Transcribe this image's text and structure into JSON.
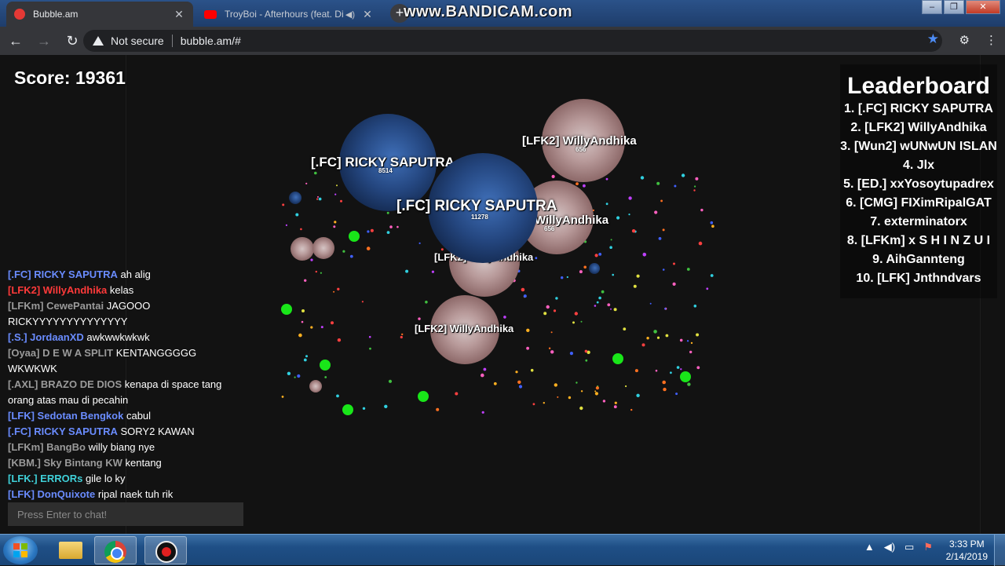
{
  "browser": {
    "tabs": [
      {
        "title": "Bubble.am",
        "active": true
      },
      {
        "title": "TroyBoi - Afterhours (feat. Di",
        "active": false
      }
    ],
    "watermark": "www.BANDICAM.com",
    "security": "Not secure",
    "url": "bubble.am/#"
  },
  "game": {
    "score": "Score: 19361",
    "leaderboard": {
      "title": "Leaderboard",
      "rows": [
        "1. [.FC] RICKY SAPUTRA",
        "2. [LFK2] WillyAndhika",
        "3. [Wun2] wUNwUN ISLAN",
        "4. Jlx",
        "5. [ED.] xxYosoytupadrex",
        "6. [CMG] FIXimRipalGAT",
        "7. exterminatorx",
        "8. [LFKm] x S H I N Z U I",
        "9. AihGannteng",
        "10. [LFK] Jnthndvars"
      ]
    },
    "chat": [
      {
        "name": "[.FC] RICKY SAPUTRA",
        "color": "#6a8cff",
        "msg": "ah alig"
      },
      {
        "name": "[LFK2] WillyAndhika",
        "color": "#ff3a3a",
        "msg": "kelas"
      },
      {
        "name": "[LFKm] CewePantai",
        "color": "#9a9a9a",
        "msg": "JAGOOO RICKYYYYYYYYYYYYYY"
      },
      {
        "name": "[.S.] JordaanXD",
        "color": "#6a8cff",
        "msg": "awkwwkwkwk"
      },
      {
        "name": "[Oyaa] D E W A SPLIT",
        "color": "#9a9a9a",
        "msg": "KENTANGGGGG WKWKWK"
      },
      {
        "name": "[.AXL] BRAZO DE DIOS",
        "color": "#9a9a9a",
        "msg": "kenapa di space tang orang atas mau di pecahin"
      },
      {
        "name": "[LFK] Sedotan Bengkok",
        "color": "#6a8cff",
        "msg": "cabul"
      },
      {
        "name": "[.FC] RICKY SAPUTRA",
        "color": "#6a8cff",
        "msg": "SORY2 KAWAN"
      },
      {
        "name": "[LFKm] BangBo",
        "color": "#9a9a9a",
        "msg": "willy biang nye"
      },
      {
        "name": "[KBM.] Sky Bintang KW",
        "color": "#9a9a9a",
        "msg": "kentang"
      },
      {
        "name": "[LFK.] ERRORs",
        "color": "#3fd0d8",
        "msg": "gile lo ky"
      },
      {
        "name": "[LFK] DonQuixote",
        "color": "#6a8cff",
        "msg": "ripal naek tuh rik"
      }
    ],
    "chat_placeholder": "Press Enter to chat!",
    "cells": [
      {
        "label": "[.FC] RICKY SAPUTRA",
        "mass": "8514"
      },
      {
        "label": "[LFK2] WillyAndhika",
        "mass": "656"
      },
      {
        "label": "[.FC] RICKY SAPUTRA",
        "mass": "11278"
      },
      {
        "label": "WillyAndhika",
        "mass": "656"
      },
      {
        "label": "[LFK2] WillyAndhika",
        "mass": "656"
      },
      {
        "label": "[LFK2] WillyAndhika",
        "mass": ""
      }
    ]
  },
  "taskbar": {
    "time": "3:33 PM",
    "date": "2/14/2019"
  }
}
